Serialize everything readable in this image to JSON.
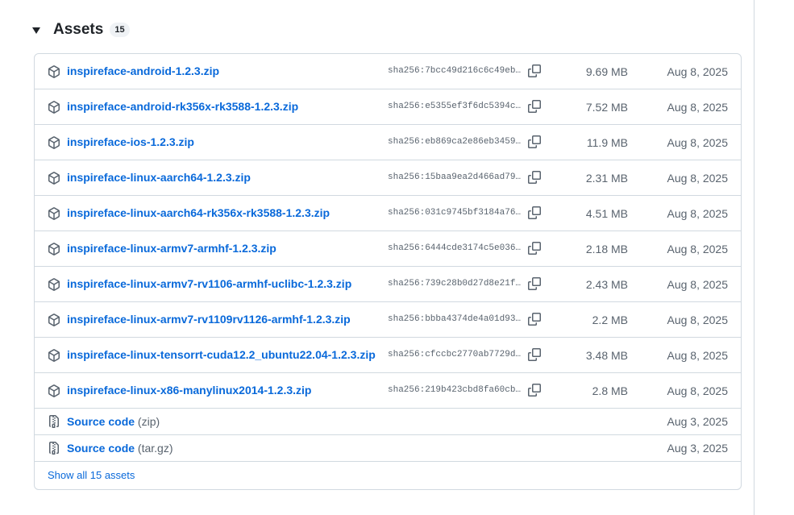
{
  "assets": {
    "title": "Assets",
    "count": "15",
    "rows": [
      {
        "name": "inspireface-android-1.2.3.zip",
        "sha": "sha256:7bcc49d216c6c49eb…",
        "size": "9.69 MB",
        "date": "Aug 8, 2025"
      },
      {
        "name": "inspireface-android-rk356x-rk3588-1.2.3.zip",
        "sha": "sha256:e5355ef3f6dc5394c…",
        "size": "7.52 MB",
        "date": "Aug 8, 2025"
      },
      {
        "name": "inspireface-ios-1.2.3.zip",
        "sha": "sha256:eb869ca2e86eb3459…",
        "size": "11.9 MB",
        "date": "Aug 8, 2025"
      },
      {
        "name": "inspireface-linux-aarch64-1.2.3.zip",
        "sha": "sha256:15baa9ea2d466ad79…",
        "size": "2.31 MB",
        "date": "Aug 8, 2025"
      },
      {
        "name": "inspireface-linux-aarch64-rk356x-rk3588-1.2.3.zip",
        "sha": "sha256:031c9745bf3184a76…",
        "size": "4.51 MB",
        "date": "Aug 8, 2025"
      },
      {
        "name": "inspireface-linux-armv7-armhf-1.2.3.zip",
        "sha": "sha256:6444cde3174c5e036…",
        "size": "2.18 MB",
        "date": "Aug 8, 2025"
      },
      {
        "name": "inspireface-linux-armv7-rv1106-armhf-uclibc-1.2.3.zip",
        "sha": "sha256:739c28b0d27d8e21f…",
        "size": "2.43 MB",
        "date": "Aug 8, 2025"
      },
      {
        "name": "inspireface-linux-armv7-rv1109rv1126-armhf-1.2.3.zip",
        "sha": "sha256:bbba4374de4a01d93…",
        "size": "2.2 MB",
        "date": "Aug 8, 2025"
      },
      {
        "name": "inspireface-linux-tensorrt-cuda12.2_ubuntu22.04-1.2.3.zip",
        "sha": "sha256:cfccbc2770ab7729d…",
        "size": "3.48 MB",
        "date": "Aug 8, 2025"
      },
      {
        "name": "inspireface-linux-x86-manylinux2014-1.2.3.zip",
        "sha": "sha256:219b423cbd8fa60cb…",
        "size": "2.8 MB",
        "date": "Aug 8, 2025"
      }
    ],
    "source_rows": [
      {
        "label": "Source code",
        "kind": "(zip)",
        "date": "Aug 3, 2025"
      },
      {
        "label": "Source code",
        "kind": "(tar.gz)",
        "date": "Aug 3, 2025"
      }
    ],
    "show_all": "Show all 15 assets"
  },
  "colors": {
    "link": "#0969da",
    "muted": "#59636e",
    "border": "#d1d9e0"
  }
}
